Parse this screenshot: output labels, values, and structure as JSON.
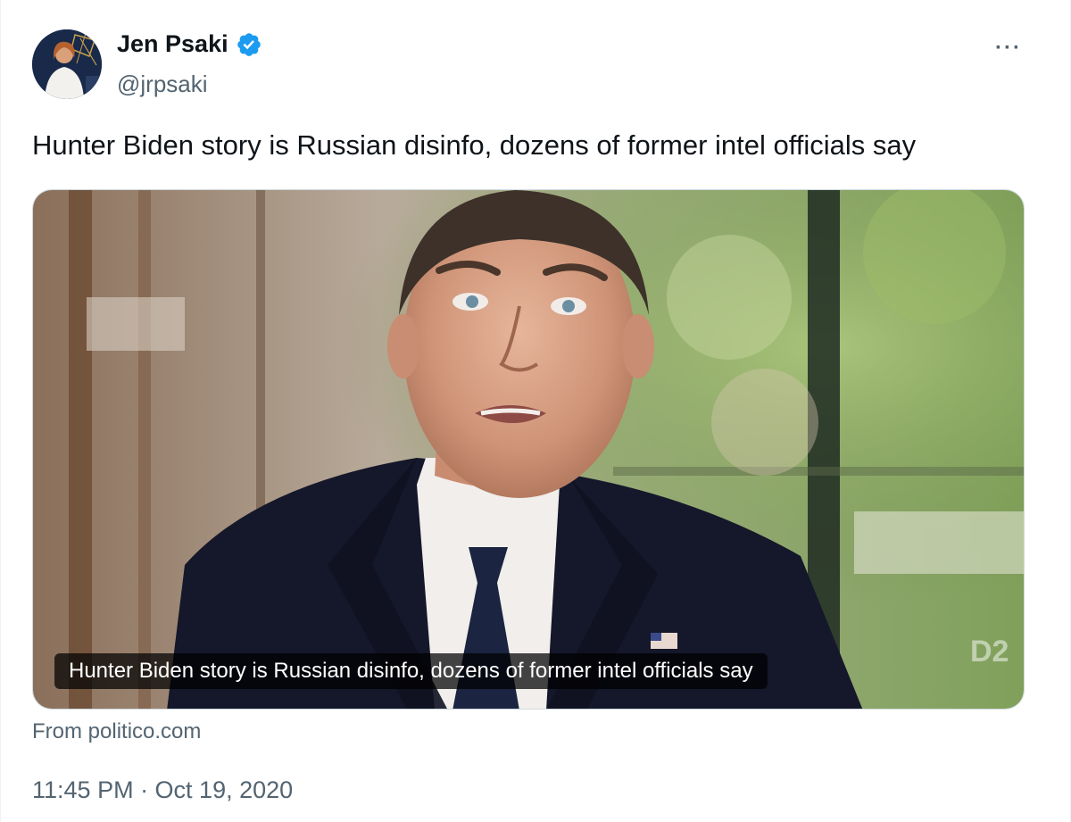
{
  "author": {
    "name": "Jen Psaki",
    "handle": "@jrpsaki",
    "verified": true,
    "verified_color": "#1d9bf0"
  },
  "more_menu": {
    "icon": "more-horizontal-icon",
    "label": "···"
  },
  "tweet": {
    "text": "Hunter Biden story is Russian disinfo, dozens of former intel officials say"
  },
  "card": {
    "headline": "Hunter Biden story is Russian disinfo, dozens of former intel officials say",
    "source": "From politico.com"
  },
  "timestamp": "11:45 PM · Oct 19, 2020",
  "colors": {
    "text_primary": "#0f1419",
    "text_secondary": "#536471",
    "border": "#cfd9de"
  }
}
